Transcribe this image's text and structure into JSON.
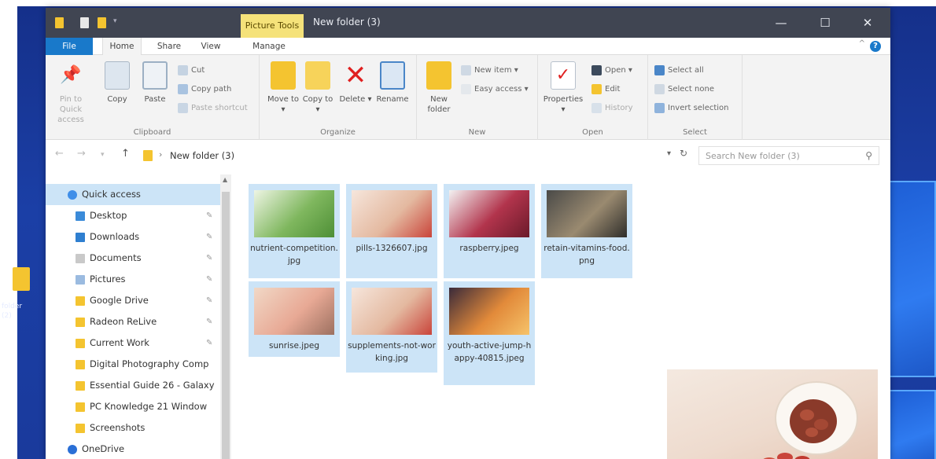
{
  "desktop": {
    "icon_label": "folder (2)"
  },
  "titlebar": {
    "contextual_tab": "Picture Tools",
    "title": "New folder (3)",
    "minimize": "—",
    "maximize": "☐",
    "close": "✕"
  },
  "tabs": [
    "File",
    "Home",
    "Share",
    "View",
    "Manage"
  ],
  "ribbon": {
    "clipboard": {
      "label": "Clipboard",
      "pin": "Pin to Quick access",
      "copy": "Copy",
      "paste": "Paste",
      "cut": "Cut",
      "copy_path": "Copy path",
      "paste_shortcut": "Paste shortcut"
    },
    "organize": {
      "label": "Organize",
      "move_to": "Move to ▾",
      "copy_to": "Copy to ▾",
      "delete": "Delete ▾",
      "rename": "Rename"
    },
    "new": {
      "label": "New",
      "new_folder": "New folder",
      "new_item": "New item ▾",
      "easy_access": "Easy access ▾"
    },
    "open": {
      "label": "Open",
      "properties": "Properties ▾",
      "open": "Open ▾",
      "edit": "Edit",
      "history": "History"
    },
    "select": {
      "label": "Select",
      "select_all": "Select all",
      "select_none": "Select none",
      "invert": "Invert selection"
    }
  },
  "address": {
    "path": "New folder (3)",
    "search_placeholder": "Search New folder (3)"
  },
  "nav": {
    "items": [
      {
        "label": "Quick access",
        "pinned": false,
        "color": "#3f8ee8"
      },
      {
        "label": "Desktop",
        "pinned": true,
        "color": "#3b8bd9"
      },
      {
        "label": "Downloads",
        "pinned": true,
        "color": "#2f7fd0"
      },
      {
        "label": "Documents",
        "pinned": true,
        "color": "#c9c9c9"
      },
      {
        "label": "Pictures",
        "pinned": true,
        "color": "#9bbbe0"
      },
      {
        "label": "Google Drive",
        "pinned": true,
        "color": "#f4c430"
      },
      {
        "label": "Radeon ReLive",
        "pinned": true,
        "color": "#f4c430"
      },
      {
        "label": "Current Work",
        "pinned": true,
        "color": "#f4c430"
      },
      {
        "label": "Digital Photography Comp",
        "pinned": false,
        "color": "#f4c430"
      },
      {
        "label": "Essential Guide 26 - Galaxy",
        "pinned": false,
        "color": "#f4c430"
      },
      {
        "label": "PC Knowledge 21 Window",
        "pinned": false,
        "color": "#f4c430"
      },
      {
        "label": "Screenshots",
        "pinned": false,
        "color": "#f4c430"
      },
      {
        "label": "OneDrive",
        "pinned": false,
        "color": "#2a6fd6"
      }
    ]
  },
  "files": [
    {
      "name": "nutrient-competition.jpg",
      "thumb": [
        "#eef5e4",
        "#7fb75e",
        "#4e8f36"
      ]
    },
    {
      "name": "pills-1326607.jpg",
      "thumb": [
        "#f6e6dc",
        "#e4b9a0",
        "#c9443a"
      ]
    },
    {
      "name": "raspberry.jpeg",
      "thumb": [
        "#f3f2f2",
        "#b2344c",
        "#6a1a2a"
      ]
    },
    {
      "name": "retain-vitamins-food.png",
      "thumb": [
        "#4a4a48",
        "#9a8a70",
        "#2e2d2a"
      ]
    },
    {
      "name": "sunrise.jpeg",
      "thumb": [
        "#f1d8c6",
        "#e8a995",
        "#9c7060"
      ]
    },
    {
      "name": "supplements-not-working.jpg",
      "thumb": [
        "#f6e6dc",
        "#e4b9a0",
        "#c9443a"
      ]
    },
    {
      "name": "youth-active-jump-happy-40815.jpeg",
      "thumb": [
        "#3a2a3a",
        "#e28a3a",
        "#f6c36a"
      ]
    }
  ]
}
